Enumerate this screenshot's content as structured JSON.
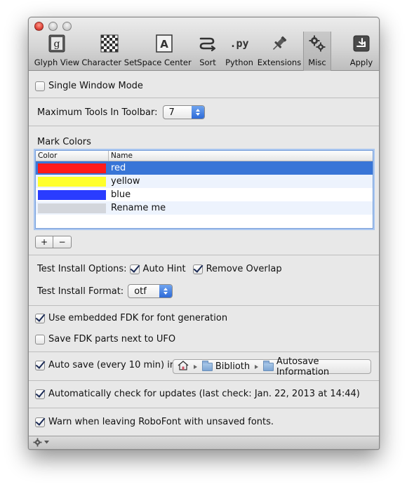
{
  "toolbar": {
    "items": [
      {
        "label": "Glyph View",
        "icon": "glyph-view-icon"
      },
      {
        "label": "Character Set",
        "icon": "character-set-icon"
      },
      {
        "label": "Space Center",
        "icon": "space-center-icon"
      },
      {
        "label": "Sort",
        "icon": "sort-icon"
      },
      {
        "label": "Python",
        "icon": "python-icon"
      },
      {
        "label": "Extensions",
        "icon": "extensions-icon"
      },
      {
        "label": "Misc",
        "icon": "misc-gears-icon",
        "selected": true
      },
      {
        "label": "Apply",
        "icon": "apply-icon"
      }
    ],
    "python_glyph": ".py",
    "glyph_view_glyph": "g",
    "space_center_glyph": "A"
  },
  "single_window": {
    "label": "Single Window Mode",
    "checked": false
  },
  "max_tools": {
    "label": "Maximum Tools In Toolbar:",
    "value": "7"
  },
  "mark_colors": {
    "title": "Mark Colors",
    "columns": [
      "Color",
      "Name"
    ],
    "rows": [
      {
        "color": "#ff1a1a",
        "name": "red",
        "selected": true
      },
      {
        "color": "#ffff2a",
        "name": "yellow"
      },
      {
        "color": "#2a3cff",
        "name": "blue"
      },
      {
        "color": "#d3d6dc",
        "name": "Rename me"
      }
    ],
    "add_label": "+",
    "remove_label": "−"
  },
  "test_install": {
    "options_label": "Test Install Options:",
    "auto_hint": {
      "label": "Auto Hint",
      "checked": true
    },
    "remove_overlap": {
      "label": "Remove Overlap",
      "checked": true
    },
    "format_label": "Test  Install  Format:",
    "format_value": "otf"
  },
  "fdk": {
    "embedded": {
      "label": "Use embedded FDK for font generation",
      "checked": true
    },
    "save_parts": {
      "label": "Save FDK parts next to UFO",
      "checked": false
    }
  },
  "autosave": {
    "label": "Auto save (every 10 min) in",
    "checked": true,
    "path": [
      "Biblioth",
      "Autosave Information"
    ]
  },
  "updates": {
    "label": "Automatically check for updates (last check: Jan. 22, 2013 at 14:44)",
    "checked": true
  },
  "warn": {
    "label": "Warn when leaving RoboFont with unsaved fonts.",
    "checked": true
  },
  "colors": {
    "selection": "#3875d7",
    "accent": "#2d6ad8"
  }
}
